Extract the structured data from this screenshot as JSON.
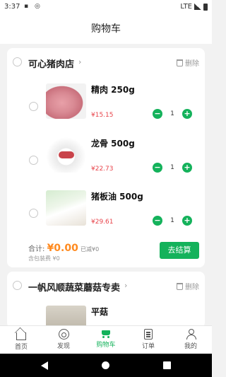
{
  "status_bar": {
    "time": "3:37",
    "network": "LTE"
  },
  "header": {
    "title": "购物车"
  },
  "stores": [
    {
      "name": "可心猪肉店",
      "delete_label": "删除",
      "items": [
        {
          "name": "精肉  250g",
          "price": "¥15.15",
          "qty": "1",
          "image": "lean-pork-image"
        },
        {
          "name": "龙骨  500g",
          "price": "¥22.73",
          "qty": "1",
          "image": "pork-spine-image"
        },
        {
          "name": "猪板油  500g",
          "price": "¥29.61",
          "qty": "1",
          "image": "pork-fat-image"
        }
      ],
      "total_label": "合计:",
      "total_amount": "¥0.00",
      "reduced": "已减¥0",
      "pack_fee": "含包装费 ¥0",
      "checkout_label": "去结算"
    },
    {
      "name": "一帆风顺蔬菜蘑菇专卖",
      "delete_label": "删除",
      "items": [
        {
          "name": "平菇",
          "image": "oyster-mushroom-image"
        }
      ]
    }
  ],
  "tabbar": {
    "items": [
      {
        "label": "首页",
        "icon": "home-icon"
      },
      {
        "label": "发现",
        "icon": "discover-icon"
      },
      {
        "label": "购物车",
        "icon": "cart-icon",
        "active": true
      },
      {
        "label": "订单",
        "icon": "order-icon"
      },
      {
        "label": "我的",
        "icon": "profile-icon"
      }
    ]
  },
  "colors": {
    "accent": "#14b25b",
    "price": "#e8434a",
    "total": "#ff8a1f"
  }
}
